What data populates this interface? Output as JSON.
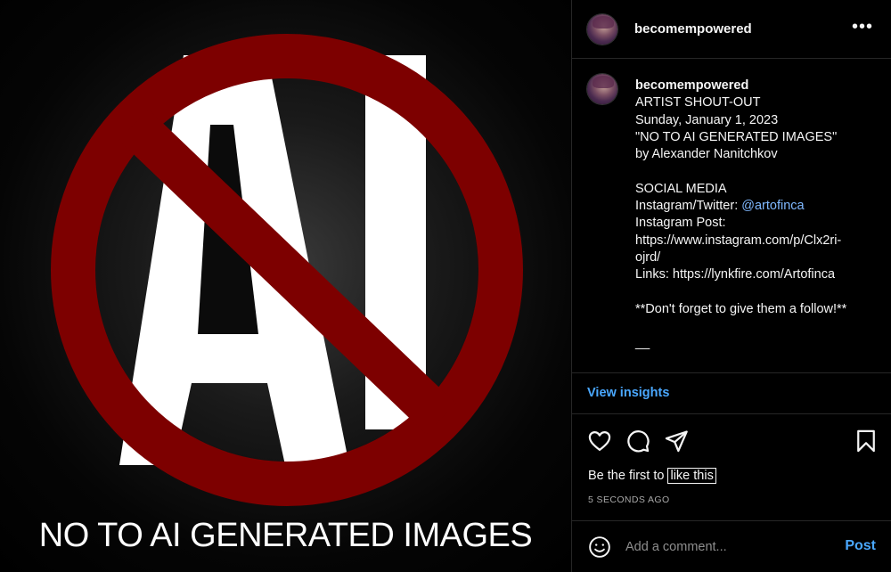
{
  "post": {
    "image": {
      "headline": "NO TO AI GENERATED IMAGES",
      "graphic_text": "AI",
      "colors": {
        "ring": "#7d0000",
        "letters": "#ffffff",
        "background": "#000000"
      }
    },
    "author": {
      "username": "becomempowered",
      "avatar": "profile-avatar"
    },
    "header": {
      "more_icon": "more-horizontal-icon",
      "more_glyph": "•••"
    },
    "caption": {
      "username": "becomempowered",
      "lines": [
        "ARTIST SHOUT-OUT",
        "Sunday, January 1, 2023",
        "\"NO TO AI GENERATED IMAGES\"",
        "by Alexander Nanitchkov",
        "",
        "SOCIAL MEDIA"
      ],
      "social_prefix": "Instagram/Twitter: ",
      "social_handle": "@artofinca",
      "post_label": "Instagram Post:",
      "post_url_1": "https://www.instagram.com/p/Clx2ri-",
      "post_url_2": "ojrd/",
      "links_line": "Links: https://lynkfire.com/Artofinca",
      "reminder": "**Don't forget to give them a follow!**",
      "separator": "__"
    },
    "insights_label": "View insights",
    "actions": {
      "icons": [
        "heart-icon",
        "comment-icon",
        "share-icon",
        "bookmark-icon"
      ]
    },
    "likes": {
      "prefix": "Be the first to",
      "link": "like this"
    },
    "timestamp": "5 SECONDS AGO",
    "comment": {
      "placeholder": "Add a comment...",
      "post_label": "Post",
      "emoji_icon": "emoji-icon"
    }
  }
}
